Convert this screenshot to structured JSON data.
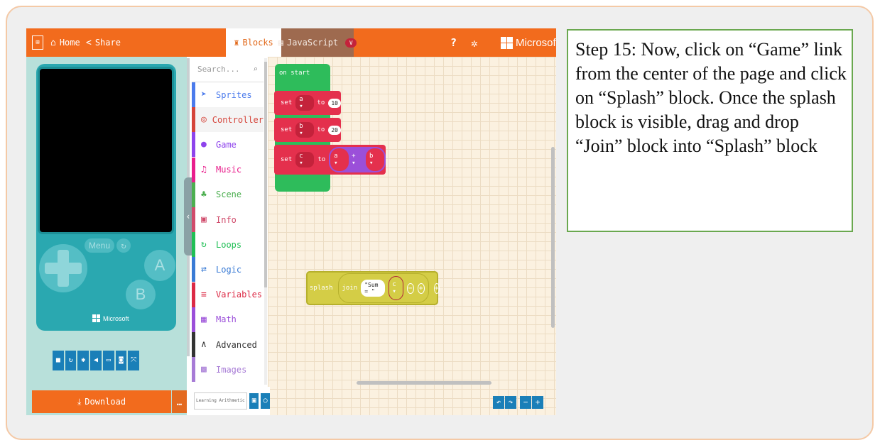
{
  "topbar": {
    "home_label": "Home",
    "share_label": "Share",
    "tab_blocks": "Blocks",
    "tab_javascript": "JavaScript",
    "brand": "Microsoft"
  },
  "colors": {
    "accent": "#f26b1d",
    "workspace": "#fbf1e0",
    "event_block": "#2ebc5b",
    "variable_block": "#e4304d",
    "math_block": "#9b4fd9",
    "game_block": "#d4cd46",
    "toolbar_button": "#1a7fb8",
    "note_border": "#6aa84f"
  },
  "simulator": {
    "menu_label": "Menu",
    "button_a": "A",
    "button_b": "B",
    "brand": "Microsoft",
    "download_label": "Download"
  },
  "toolbox": {
    "search_placeholder": "Search...",
    "categories": [
      {
        "label": "Sprites",
        "icon": "paper-plane-icon",
        "glyph": "➤",
        "color": "#4b7bec"
      },
      {
        "label": "Controller",
        "icon": "gamepad-icon",
        "glyph": "◎",
        "color": "#d5443a"
      },
      {
        "label": "Game",
        "icon": "circle-icon",
        "glyph": "●",
        "color": "#8e44ec"
      },
      {
        "label": "Music",
        "icon": "headphones-icon",
        "glyph": "♫",
        "color": "#e91e8c"
      },
      {
        "label": "Scene",
        "icon": "tree-icon",
        "glyph": "♣",
        "color": "#4caf50"
      },
      {
        "label": "Info",
        "icon": "id-card-icon",
        "glyph": "▣",
        "color": "#d04b6b"
      },
      {
        "label": "Loops",
        "icon": "refresh-icon",
        "glyph": "↻",
        "color": "#20bf55"
      },
      {
        "label": "Logic",
        "icon": "shuffle-icon",
        "glyph": "⇄",
        "color": "#3a7bd5"
      },
      {
        "label": "Variables",
        "icon": "list-icon",
        "glyph": "≡",
        "color": "#dc2a45"
      },
      {
        "label": "Math",
        "icon": "calculator-icon",
        "glyph": "▦",
        "color": "#9b4fd9"
      },
      {
        "label": "Advanced",
        "icon": "chevron-up-icon",
        "glyph": "∧",
        "color": "#333333"
      },
      {
        "label": "Images",
        "icon": "image-icon",
        "glyph": "▩",
        "color": "#a77bd6"
      }
    ]
  },
  "workspace": {
    "on_start": "on start",
    "rows": [
      {
        "kw": "set",
        "var": "a ▾",
        "to": "to",
        "value": "10"
      },
      {
        "kw": "set",
        "var": "b ▾",
        "to": "to",
        "value": "20"
      }
    ],
    "sum_row": {
      "kw": "set",
      "var": "c ▾",
      "to": "to",
      "left": "a ▾",
      "op": "+ ▾",
      "right": "b ▾"
    },
    "splash": {
      "label": "splash",
      "join": "join",
      "string": "\"Sum = \"",
      "var": "c ▾"
    }
  },
  "bottom": {
    "project_name": "Learning Arithmetic Ope"
  },
  "note": {
    "text": "Step 15: Now, click on “Game” link from the center of the page and click on “Splash” block. Once the splash block is visible, drag and drop “Join” block into “Splash” block"
  }
}
